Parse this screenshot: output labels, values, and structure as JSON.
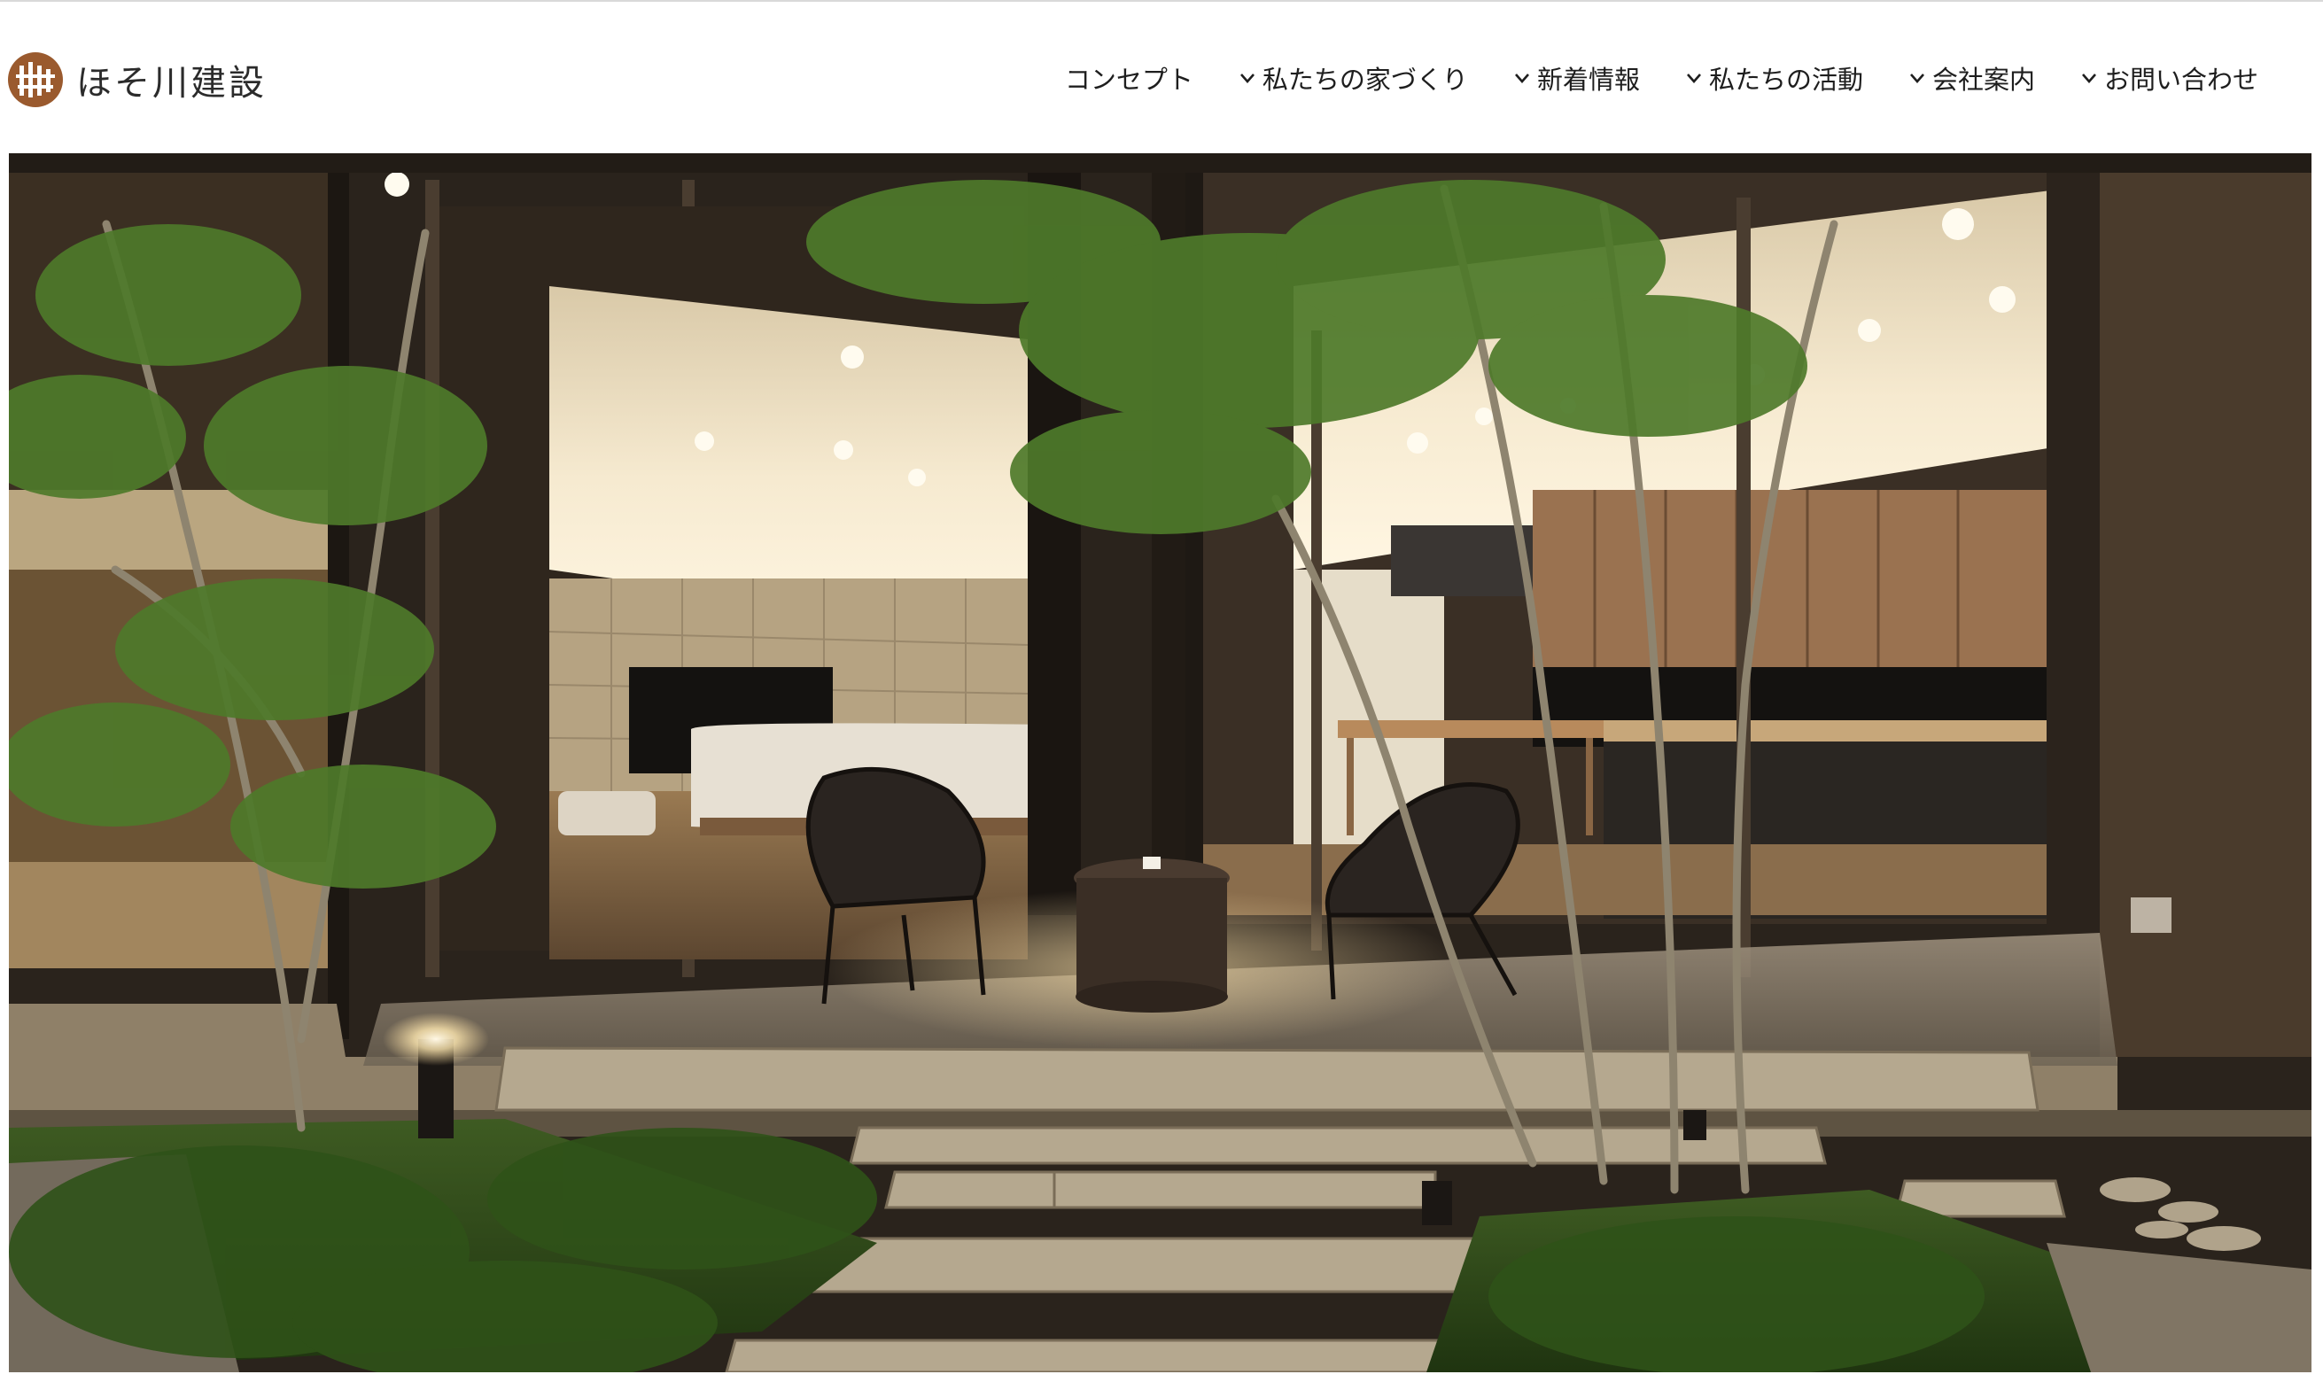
{
  "brand": {
    "name": "ほそ川建設",
    "logo_icon": "brand-logo-icon",
    "logo_color": "#9a5a2e"
  },
  "nav": {
    "items": [
      {
        "label": "コンセプト",
        "has_dropdown": false
      },
      {
        "label": "私たちの家づくり",
        "has_dropdown": true
      },
      {
        "label": "新着情報",
        "has_dropdown": true
      },
      {
        "label": "私たちの活動",
        "has_dropdown": true
      },
      {
        "label": "会社案内",
        "has_dropdown": true
      },
      {
        "label": "お問い合わせ",
        "has_dropdown": true
      }
    ],
    "dropdown_icon": "chevron-down-icon"
  },
  "hero": {
    "image_subject": "night courtyard garden with lit living room and patio chairs"
  }
}
